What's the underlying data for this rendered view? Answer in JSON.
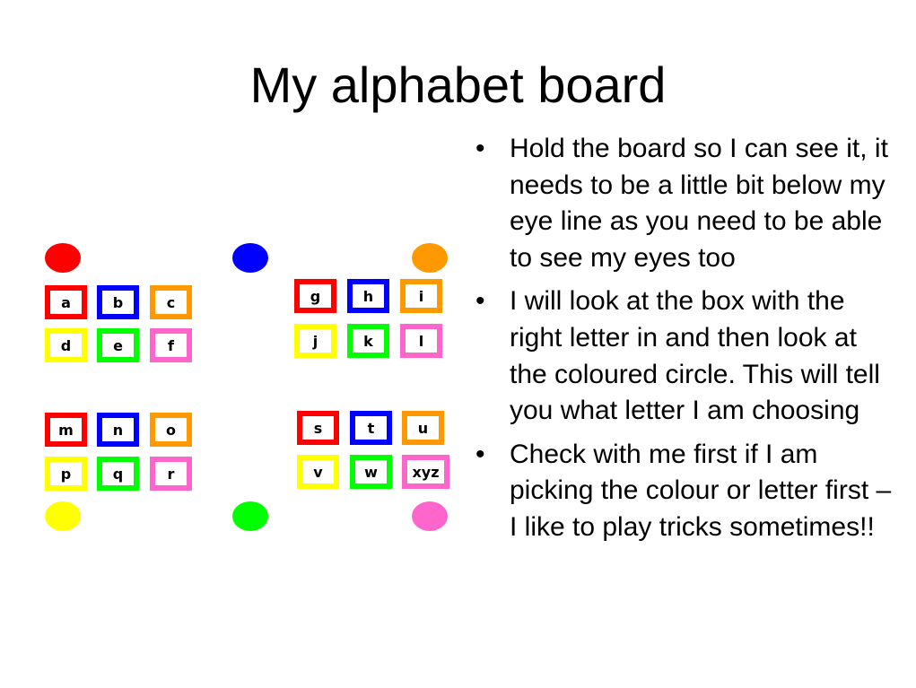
{
  "title": "My alphabet board",
  "colors": {
    "red": "#ff0000",
    "blue": "#0000ff",
    "orange": "#ff9900",
    "yellow": "#ffff00",
    "green": "#00ff00",
    "pink": "#ff66cc"
  },
  "board": {
    "circles": [
      "red",
      "blue",
      "orange",
      "yellow",
      "green",
      "pink"
    ],
    "groups": [
      {
        "boxes": [
          {
            "letter": "a",
            "color": "red"
          },
          {
            "letter": "b",
            "color": "blue"
          },
          {
            "letter": "c",
            "color": "orange"
          },
          {
            "letter": "d",
            "color": "yellow"
          },
          {
            "letter": "e",
            "color": "green"
          },
          {
            "letter": "f",
            "color": "pink"
          }
        ]
      },
      {
        "boxes": [
          {
            "letter": "g",
            "color": "red"
          },
          {
            "letter": "h",
            "color": "blue"
          },
          {
            "letter": "i",
            "color": "orange"
          },
          {
            "letter": "j",
            "color": "yellow"
          },
          {
            "letter": "k",
            "color": "green"
          },
          {
            "letter": "l",
            "color": "pink"
          }
        ]
      },
      {
        "boxes": [
          {
            "letter": "m",
            "color": "red"
          },
          {
            "letter": "n",
            "color": "blue"
          },
          {
            "letter": "o",
            "color": "orange"
          },
          {
            "letter": "p",
            "color": "yellow"
          },
          {
            "letter": "q",
            "color": "green"
          },
          {
            "letter": "r",
            "color": "pink"
          }
        ]
      },
      {
        "boxes": [
          {
            "letter": "s",
            "color": "red"
          },
          {
            "letter": "t",
            "color": "blue"
          },
          {
            "letter": "u",
            "color": "orange"
          },
          {
            "letter": "v",
            "color": "yellow"
          },
          {
            "letter": "w",
            "color": "green"
          },
          {
            "letter": "xyz",
            "color": "pink"
          }
        ]
      }
    ]
  },
  "bullets": {
    "mark": "•",
    "items": [
      "Hold the board so I can see it, it needs to be a little bit below my eye line as you need to be able to see my eyes too",
      "I will look at the box with the right letter in and then look at the coloured circle. This will tell you what letter I am choosing",
      "Check with me first if I am picking the colour or letter first – I like to play tricks sometimes!!"
    ]
  }
}
